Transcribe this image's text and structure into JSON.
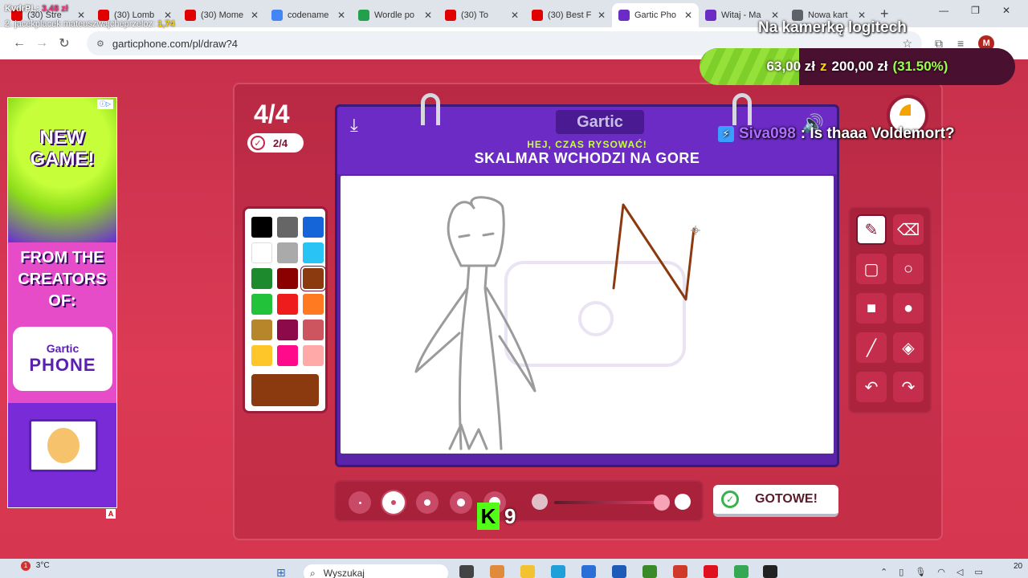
{
  "browser": {
    "tabs": [
      {
        "title": "(30) Stre",
        "color": "#e00000"
      },
      {
        "title": "(30) Lomb",
        "color": "#e00000"
      },
      {
        "title": "(30) Mome",
        "color": "#e00000"
      },
      {
        "title": "codename",
        "color": "#4285f4"
      },
      {
        "title": "Wordle po",
        "color": "#22a04b"
      },
      {
        "title": "(30) To",
        "color": "#e00000"
      },
      {
        "title": "(30) Best F",
        "color": "#e00000"
      },
      {
        "title": "Gartic Pho",
        "color": "#6b2bc4"
      },
      {
        "title": "Witaj - Ma",
        "color": "#6b2bc4"
      },
      {
        "title": "Nowa kart",
        "color": "#5f6368"
      }
    ],
    "new_tab": "+",
    "url": "garticphone.com/pl/draw?4",
    "profile_initial": "M"
  },
  "overlay": {
    "donor1_name": "KvdrPL:",
    "donor1_amount": "3,48 zł",
    "donor2_name": "2. jacekplacek mateuszwajcheprzeloz:",
    "donor2_amount": "1,74",
    "camera_label": "Na kamerkę logitech",
    "goal_current": "63,00 zł",
    "goal_z": "z",
    "goal_target": "200,00 zł",
    "goal_pct": "(31.50%)",
    "goal_fraction": 0.315,
    "kick_count": "9",
    "chat_user": "Siva098",
    "chat_message": ": Is thaaa Voldemort?"
  },
  "ad": {
    "headline": "NEW GAME!",
    "subline": "FROM THE CREATORS OF:",
    "logo_top": "Gartic",
    "logo_bottom": "PHONE"
  },
  "game": {
    "round": "4/4",
    "done_count": "2/4",
    "brand": "Gartic",
    "hint": "HEJ, CZAS RYSOWAĆ!",
    "prompt": "SKALMAR WCHODZI NA GORE",
    "done_button": "GOTOWE!",
    "current_color": "#8b3a10",
    "palette": [
      "#000000",
      "#666666",
      "#1565d8",
      "#ffffff",
      "#aaaaaa",
      "#29c3f6",
      "#1e8a2e",
      "#8b0000",
      "#8b3a10",
      "#22c33a",
      "#ee1c1c",
      "#ff7a21",
      "#b8862a",
      "#8c0a4a",
      "#cc5560",
      "#ffc629",
      "#ff0a8a",
      "#ffaaa8"
    ],
    "selected_color_index": 8
  },
  "taskbar": {
    "temperature": "3°C",
    "notif": "1",
    "search_placeholder": "Wyszukaj",
    "clock": "20"
  }
}
